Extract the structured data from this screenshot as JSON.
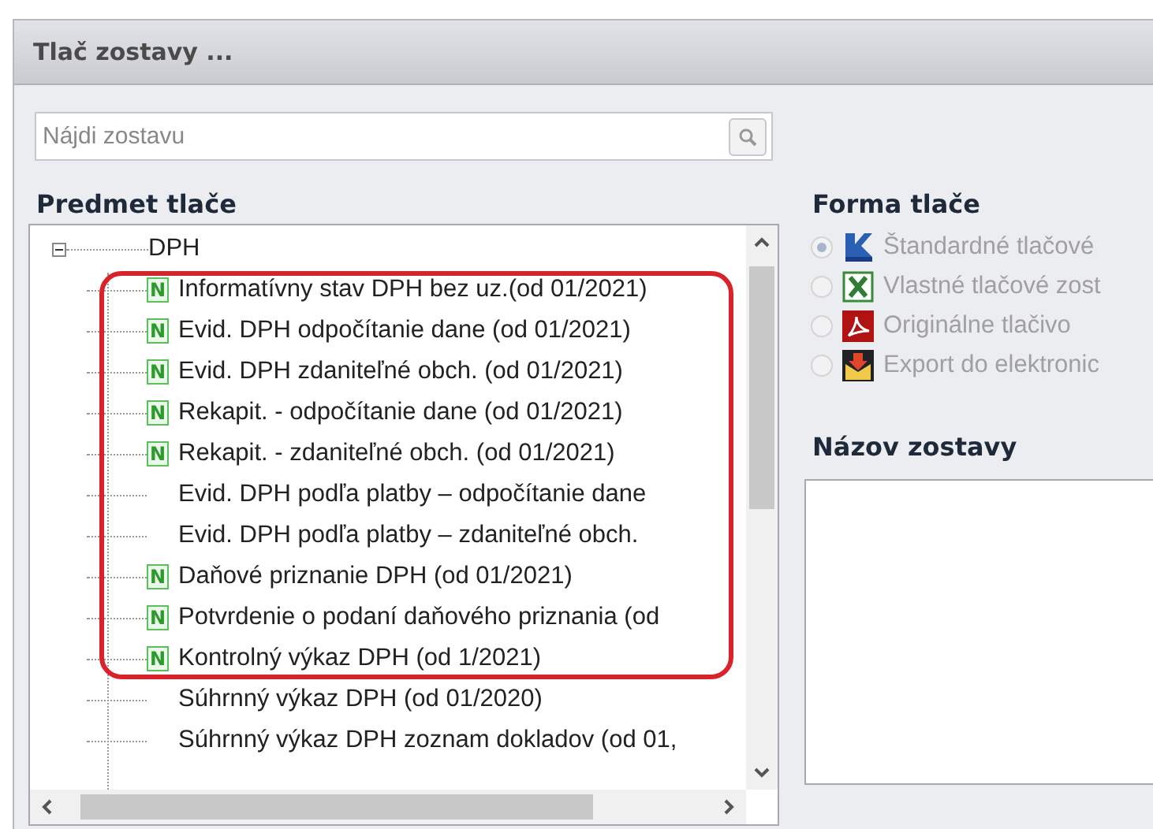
{
  "window": {
    "title": "Tlač zostavy ..."
  },
  "search": {
    "placeholder": "Nájdi zostavu"
  },
  "subject": {
    "heading": "Predmet tlače",
    "tree": [
      {
        "label": "DPH",
        "expanded": true,
        "children": [
          {
            "label": "Informatívny stav DPH bez uz.(od 01/2021)",
            "badge": "N"
          },
          {
            "label": "Evid. DPH odpočítanie dane (od 01/2021)",
            "badge": "N"
          },
          {
            "label": "Evid. DPH zdaniteľné obch. (od 01/2021)",
            "badge": "N"
          },
          {
            "label": "Rekapit. - odpočítanie dane (od 01/2021)",
            "badge": "N"
          },
          {
            "label": "Rekapit. - zdaniteľné obch. (od 01/2021)",
            "badge": "N"
          },
          {
            "label": "Evid. DPH podľa platby – odpočítanie dane"
          },
          {
            "label": "Evid. DPH podľa platby – zdaniteľné obch."
          },
          {
            "label": "Daňové priznanie DPH (od 01/2021)",
            "badge": "N"
          },
          {
            "label": "Potvrdenie o podaní daňového priznania (od",
            "badge": "N"
          },
          {
            "label": "Kontrolný výkaz DPH (od 1/2021)",
            "badge": "N"
          },
          {
            "label": "Súhrnný výkaz DPH (od 01/2020)"
          },
          {
            "label": "Súhrnný výkaz DPH zoznam dokladov (od 01,"
          }
        ]
      }
    ]
  },
  "form": {
    "heading": "Forma tlače",
    "options": [
      {
        "label": "Štandardné tlačové",
        "kind": "kros",
        "selected": true,
        "disabled": true
      },
      {
        "label": "Vlastné tlačové zost",
        "kind": "excel",
        "selected": false,
        "disabled": true
      },
      {
        "label": "Originálne tlačivo",
        "kind": "pdf",
        "selected": false,
        "disabled": true
      },
      {
        "label": "Export do elektronic",
        "kind": "export",
        "selected": false,
        "disabled": true
      }
    ]
  },
  "report_name": {
    "heading": "Názov zostavy"
  }
}
